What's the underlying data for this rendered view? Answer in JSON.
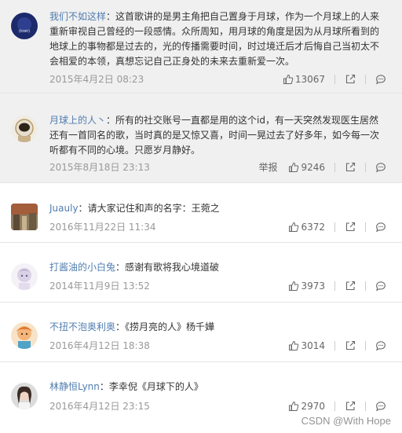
{
  "comments": [
    {
      "username": "我们不如这样",
      "separator": "：",
      "text": "这首歌讲的是男主角把自己置身于月球，作为一个月球上的人来重新审视自己曾经的一段感情。众所周知，用月球的角度是因为从月球所看到的地球上的事物都是过去的，光的传播需要时间，时过境迁后才后悔自己当初太不会相爱的本领，真想忘记自己正身处的未来去重新爱一次。",
      "time": "2015年4月2日 08:23",
      "likes": "13067",
      "avatar_icon": "avatar-navy-icon"
    },
    {
      "username": "月球上的人丶",
      "separator": "：",
      "text": "所有的社交账号一直都是用的这个id，有一天突然发现医生居然还有一首同名的歌，当时真的是又惊又喜，时间一晃过去了好多年，如今每一次听都有不同的心境。只愿岁月静好。",
      "time": "2015年8月18日 23:13",
      "report": "举报",
      "likes": "9246",
      "avatar_icon": "avatar-astronaut-icon"
    },
    {
      "username": "Juauly",
      "separator": "：",
      "text": "请大家记住和声的名字：王菀之",
      "time": "2016年11月22日 11:34",
      "likes": "6372",
      "avatar_icon": "avatar-photo-icon"
    },
    {
      "username": "打酱油的小白兔",
      "separator": "：",
      "text": "感谢有歌将我心境道破",
      "time": "2014年11月9日 13:52",
      "likes": "3973",
      "avatar_icon": "avatar-anime-icon"
    },
    {
      "username": "不扭不泡奥利奥",
      "separator": "：",
      "text": "《捞月亮的人》杨千嬅",
      "time": "2016年4月12日 18:38",
      "likes": "3014",
      "avatar_icon": "avatar-cartoon-icon"
    },
    {
      "username": "林静恒Lynn",
      "separator": "：",
      "text": "李幸倪《月球下的人》",
      "time": "2016年4月12日 23:15",
      "likes": "2970",
      "avatar_icon": "avatar-girl-icon"
    }
  ],
  "watermark": "CSDN @With Hope",
  "colors": {
    "username": "#507daf",
    "time": "#999999",
    "highlight_bg": "#f0f0f0"
  }
}
